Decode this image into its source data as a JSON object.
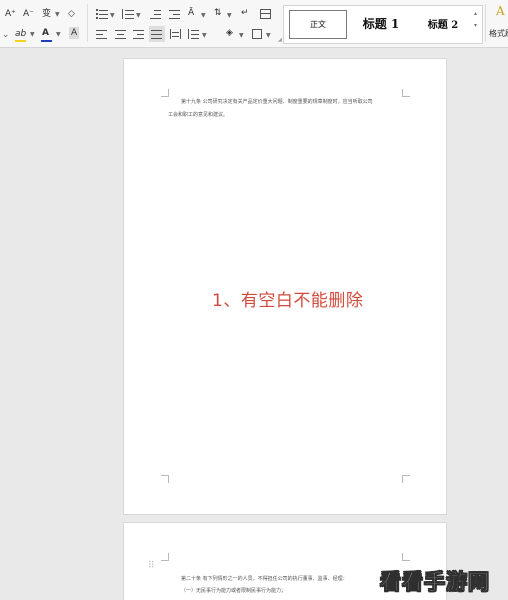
{
  "ribbon": {
    "font_controls": {
      "grow_font": "A⁺",
      "shrink_font": "A⁻",
      "phonetic_guide": "变",
      "clear_format": "◇",
      "highlight": "ab",
      "font_color": "A",
      "char_shading": "A",
      "font_color_value": "#1f3fbf",
      "highlight_color_value": "#f2d21a"
    },
    "styles": {
      "normal": "正文",
      "heading1": "标题 1",
      "heading2": "标题 2",
      "more_label": "格式刷"
    }
  },
  "document": {
    "page1_lines": [
      "第十九条  公司研究决定有关产品定价重大问题、制度重要的规章制度时，应当听取公司",
      "工会和职工的意见和建议。"
    ],
    "page2_lines": [
      "第二十条  有下列情形之一的人员，不得担任公司的执行董事、监事、经理：",
      "（一）无民事行为能力或者限制民事行为能力；"
    ]
  },
  "overlay_caption": "1、有空白不能删除",
  "watermark": "看看手游网"
}
